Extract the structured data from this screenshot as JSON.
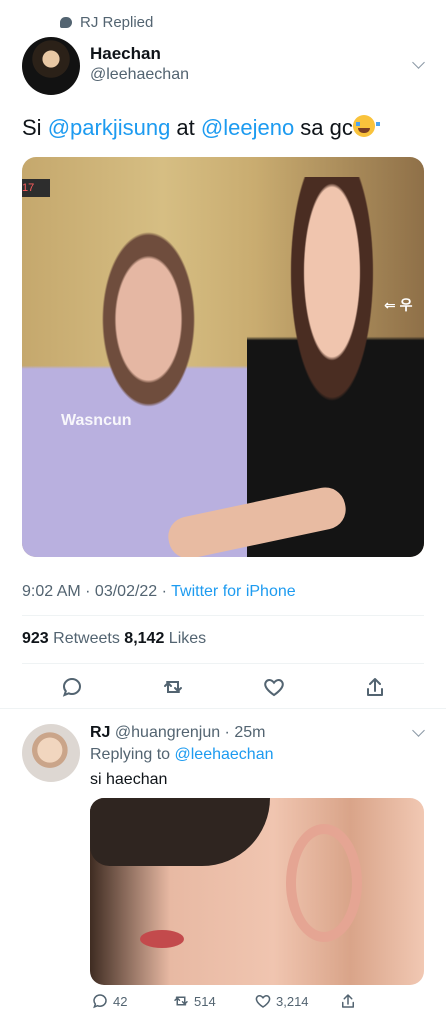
{
  "context": {
    "replied_label": "RJ Replied"
  },
  "tweet": {
    "author": {
      "name": "Haechan",
      "handle": "@leehaechan"
    },
    "text_parts": [
      {
        "text": "Si ",
        "type": "plain"
      },
      {
        "text": "@parkjisung",
        "type": "mention"
      },
      {
        "text": " at ",
        "type": "plain"
      },
      {
        "text": "@leejeno",
        "type": "mention"
      },
      {
        "text": " sa gc",
        "type": "plain"
      }
    ],
    "media": {
      "top_left_tag": "17",
      "shirt_text": "Wasncun",
      "right_mark": "⇐ 우"
    },
    "meta": {
      "time_date": "9:02 AM · 03/02/22 · ",
      "source": "Twitter for iPhone"
    },
    "stats": {
      "retweets_count": "923",
      "retweets_label": " Retweets ",
      "likes_count": "8,142",
      "likes_label": " Likes"
    },
    "actions": {
      "reply_icon": "comment-icon",
      "retweet_icon": "retweet-icon",
      "like_icon": "heart-icon",
      "share_icon": "share-icon"
    }
  },
  "reply": {
    "author": {
      "name": "RJ",
      "handle_time": " @huangrenjun · 25m"
    },
    "replying_prefix": "Replying to ",
    "replying_target": "@leehaechan",
    "text": "si haechan",
    "stats": {
      "replies": "42",
      "retweets": "514",
      "likes": "3,214"
    }
  },
  "colors": {
    "accent": "#1d9bf0",
    "muted": "#536471",
    "divider": "#eff3f4"
  }
}
